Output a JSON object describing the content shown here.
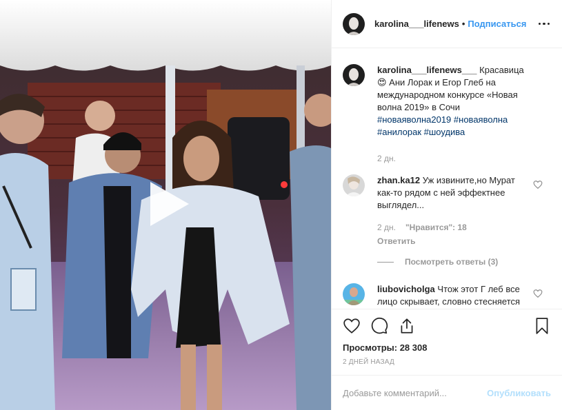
{
  "post": {
    "author": "karolina___lifenews",
    "separator": "•",
    "follow_label": "Подписаться",
    "more_icon": "more-horizontal-icon"
  },
  "caption": {
    "user": "karolina___lifenews___",
    "text": " Красавица 😍 Ани Лорак и Егор Глеб на международном конкурсе «Новая волна 2019» в Сочи ",
    "hashtags": [
      "#новаяволна2019",
      "#новаяволна",
      "#анилорак",
      "#шоудива"
    ],
    "time": "2 дн."
  },
  "comments": [
    {
      "user": "zhan.ka12",
      "text": " Уж извините,но Мурат как-то рядом с ней эффектнее выглядел...",
      "time": "2 дн.",
      "likes": "\"Нравится\": 18",
      "reply": "Ответить",
      "view_replies": "Посмотреть ответы (3)"
    },
    {
      "user": "liubovicholga",
      "text": " Чтож этот Г леб все лицо скрывает, словно стесняется или боится чего."
    }
  ],
  "actions": {
    "views": "Просмотры: 28 308",
    "time_ago": "2 ДНЕЙ НАЗАД"
  },
  "add_comment": {
    "placeholder": "Добавьте комментарий...",
    "publish": "Опубликовать"
  },
  "colors": {
    "link": "#3897f0",
    "hashtag": "#003569",
    "muted": "#999999",
    "publish_disabled": "#b2dffc"
  }
}
